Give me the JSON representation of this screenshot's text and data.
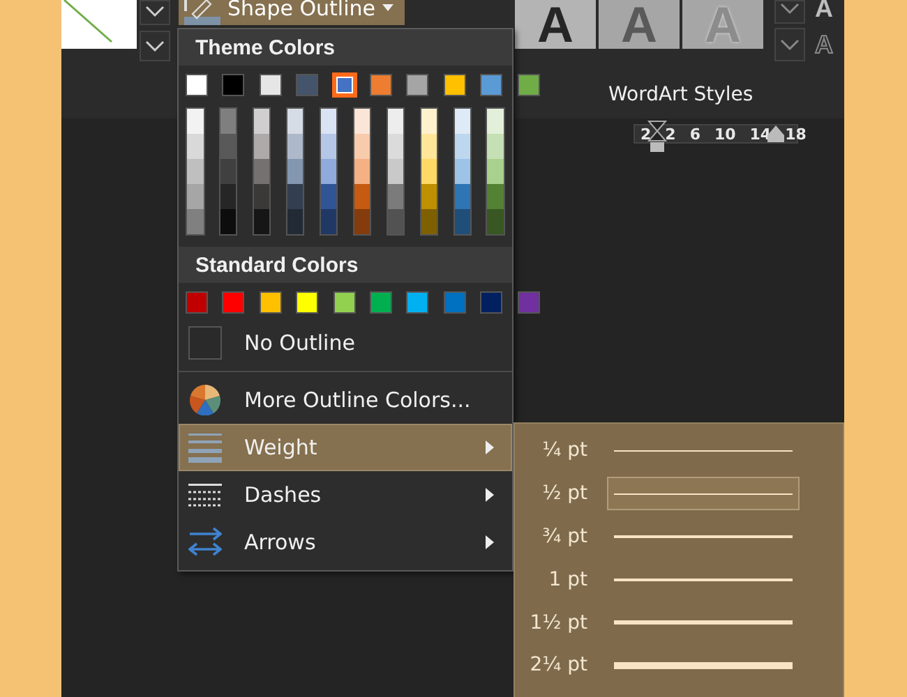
{
  "ribbon": {
    "shape_outline_button": {
      "label": "Shape Outline",
      "pressed": true
    },
    "wordart_samples": [
      {
        "letter": "A",
        "kind": "dark"
      },
      {
        "letter": "A",
        "kind": "gray"
      },
      {
        "letter": "A",
        "kind": "raised"
      }
    ],
    "side_letters": [
      {
        "letter": "A",
        "kind": "fill"
      },
      {
        "letter": "A",
        "kind": "outline"
      }
    ],
    "group_label": "WordArt Styles",
    "ruler_labels": [
      "2",
      "2",
      "6",
      "10",
      "14",
      "18"
    ]
  },
  "outline_menu": {
    "theme_colors": {
      "title": "Theme Colors",
      "swatches": [
        {
          "color": "#ffffff",
          "selected": false,
          "shades": [
            {
              "color": "#f2f2f2"
            },
            {
              "color": "#d9d9d9"
            },
            {
              "color": "#bfbfbf"
            },
            {
              "color": "#a6a6a6"
            },
            {
              "color": "#808080"
            }
          ]
        },
        {
          "color": "#000000",
          "selected": false,
          "shades": [
            {
              "color": "#7f7f7f"
            },
            {
              "color": "#595959"
            },
            {
              "color": "#404040"
            },
            {
              "color": "#262626"
            },
            {
              "color": "#0d0d0d"
            }
          ]
        },
        {
          "color": "#e7e6e6",
          "selected": false,
          "shades": [
            {
              "color": "#d0cece"
            },
            {
              "color": "#aeaaaa"
            },
            {
              "color": "#767171"
            },
            {
              "color": "#3b3838"
            },
            {
              "color": "#171616"
            }
          ]
        },
        {
          "color": "#44546a",
          "selected": false,
          "shades": [
            {
              "color": "#d6dce5"
            },
            {
              "color": "#adb9ca"
            },
            {
              "color": "#8497b0"
            },
            {
              "color": "#333f50"
            },
            {
              "color": "#222a35"
            }
          ]
        },
        {
          "color": "#4472c4",
          "selected": true,
          "shades": [
            {
              "color": "#dae3f3"
            },
            {
              "color": "#b4c7e7"
            },
            {
              "color": "#8faadc"
            },
            {
              "color": "#2f5597"
            },
            {
              "color": "#203864"
            }
          ]
        },
        {
          "color": "#ed7d31",
          "selected": false,
          "shades": [
            {
              "color": "#fbe5d6"
            },
            {
              "color": "#f8cbad"
            },
            {
              "color": "#f4b183"
            },
            {
              "color": "#c55a11"
            },
            {
              "color": "#843c0c"
            }
          ]
        },
        {
          "color": "#a5a5a5",
          "selected": false,
          "shades": [
            {
              "color": "#ededed"
            },
            {
              "color": "#dbdbdb"
            },
            {
              "color": "#c9c9c9"
            },
            {
              "color": "#7b7b7b"
            },
            {
              "color": "#525252"
            }
          ]
        },
        {
          "color": "#ffc000",
          "selected": false,
          "shades": [
            {
              "color": "#fff2cc"
            },
            {
              "color": "#ffe699"
            },
            {
              "color": "#ffd966"
            },
            {
              "color": "#bf9000"
            },
            {
              "color": "#7f6000"
            }
          ]
        },
        {
          "color": "#5b9bd5",
          "selected": false,
          "shades": [
            {
              "color": "#deebf7"
            },
            {
              "color": "#bdd7ee"
            },
            {
              "color": "#9dc3e6"
            },
            {
              "color": "#2e75b6"
            },
            {
              "color": "#1f4e79"
            }
          ]
        },
        {
          "color": "#70ad47",
          "selected": false,
          "shades": [
            {
              "color": "#e2f0d9"
            },
            {
              "color": "#c5e0b4"
            },
            {
              "color": "#a9d18e"
            },
            {
              "color": "#548235"
            },
            {
              "color": "#385723"
            }
          ]
        }
      ]
    },
    "standard_colors": {
      "title": "Standard Colors",
      "swatches": [
        {
          "color": "#c00000",
          "selected": false
        },
        {
          "color": "#ff0000",
          "selected": false
        },
        {
          "color": "#ffc000",
          "selected": false
        },
        {
          "color": "#ffff00",
          "selected": false
        },
        {
          "color": "#92d050",
          "selected": false
        },
        {
          "color": "#00b050",
          "selected": false
        },
        {
          "color": "#00b0f0",
          "selected": false
        },
        {
          "color": "#0070c0",
          "selected": false
        },
        {
          "color": "#002060",
          "selected": false
        },
        {
          "color": "#7030a0",
          "selected": false
        }
      ]
    },
    "items": [
      {
        "kind": "no-outline",
        "label": "No Outline",
        "highlighted": false,
        "submenu": false
      },
      {
        "kind": "more-colors",
        "label": "More Outline Colors...",
        "highlighted": false,
        "submenu": false
      },
      {
        "kind": "weight",
        "label": "Weight",
        "highlighted": true,
        "submenu": true
      },
      {
        "kind": "dashes",
        "label": "Dashes",
        "highlighted": false,
        "submenu": true
      },
      {
        "kind": "arrows",
        "label": "Arrows",
        "highlighted": false,
        "submenu": true
      }
    ]
  },
  "weight_submenu": {
    "items": [
      {
        "label": "¼ pt",
        "selected": false
      },
      {
        "label": "½ pt",
        "selected": true
      },
      {
        "label": "¾ pt",
        "selected": false
      },
      {
        "label": "1 pt",
        "selected": false
      },
      {
        "label": "1½ pt",
        "selected": false
      },
      {
        "label": "2¼ pt",
        "selected": false
      }
    ]
  }
}
